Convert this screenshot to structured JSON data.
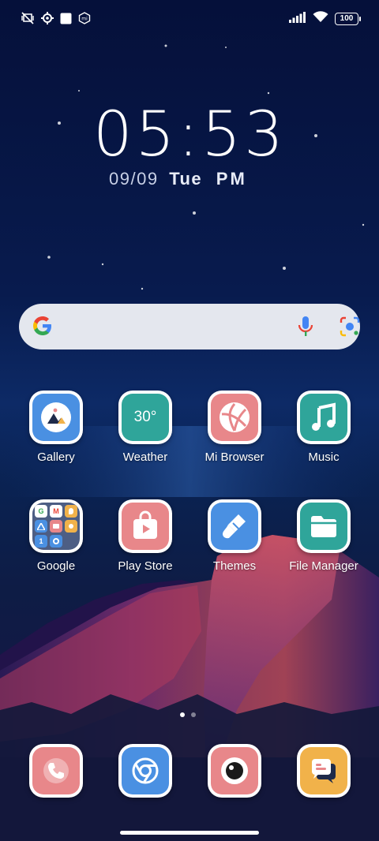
{
  "status_bar": {
    "left_icons": [
      "vibrate-off-icon",
      "settings-gear-icon",
      "square-notification-icon",
      "mi-icon"
    ],
    "right_icons": [
      "signal-icon",
      "wifi-icon"
    ],
    "battery": "100"
  },
  "lockclock": {
    "time": "05:53",
    "date": "09/09",
    "day": "Tue",
    "ampm": "PM"
  },
  "search": {
    "logo": "google-g-icon",
    "mic": "mic-icon",
    "lens": "google-lens-icon"
  },
  "apps_row1": [
    {
      "label": "Gallery"
    },
    {
      "label": "Weather",
      "badge": "30°"
    },
    {
      "label": "Mi Browser"
    },
    {
      "label": "Music"
    }
  ],
  "apps_row2": [
    {
      "label": "Google"
    },
    {
      "label": "Play Store"
    },
    {
      "label": "Themes"
    },
    {
      "label": "File Manager"
    }
  ],
  "dock": [
    {
      "name": "phone-icon"
    },
    {
      "name": "chrome-icon"
    },
    {
      "name": "camera-icon"
    },
    {
      "name": "messages-icon"
    }
  ],
  "page_indicator": {
    "pages": 2,
    "current": 1
  },
  "colors": {
    "blue": "#4a90e2",
    "teal": "#2fa59a",
    "salmon": "#e8878a",
    "yellow": "#f1b24a"
  }
}
